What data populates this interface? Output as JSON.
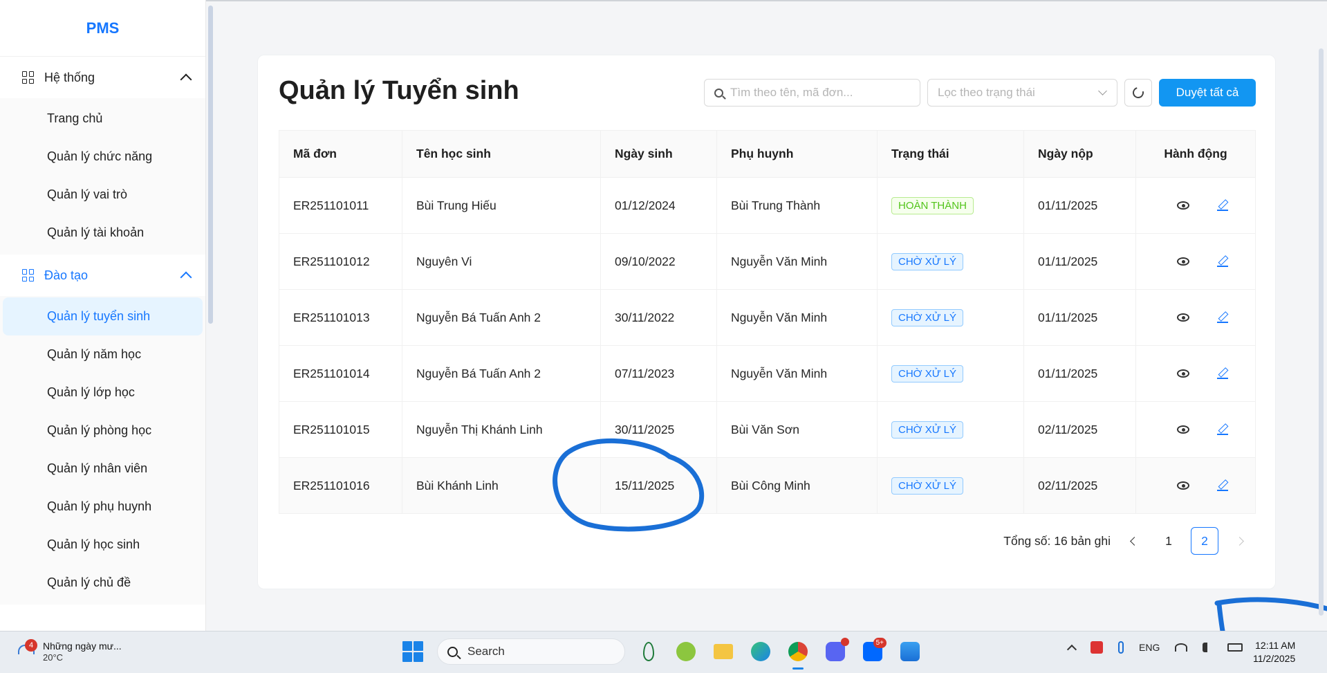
{
  "sidebar": {
    "logo": "PMS",
    "groups": [
      {
        "label": "Hệ thống",
        "items": [
          "Trang chủ",
          "Quản lý chức năng",
          "Quản lý vai trò",
          "Quản lý tài khoản"
        ]
      },
      {
        "label": "Đào tạo",
        "items": [
          "Quản lý tuyển sinh",
          "Quản lý năm học",
          "Quản lý lớp học",
          "Quản lý phòng học",
          "Quản lý nhân viên",
          "Quản lý phụ huynh",
          "Quản lý học sinh",
          "Quản lý chủ đề"
        ],
        "selected": "Quản lý tuyển sinh"
      }
    ]
  },
  "page": {
    "title": "Quản lý Tuyển sinh",
    "search_placeholder": "Tìm theo tên, mã đơn...",
    "filter_placeholder": "Lọc theo trạng thái",
    "approve_all_label": "Duyệt tất cả"
  },
  "table": {
    "columns": [
      "Mã đơn",
      "Tên học sinh",
      "Ngày sinh",
      "Phụ huynh",
      "Trạng thái",
      "Ngày nộp",
      "Hành động"
    ],
    "rows": [
      {
        "code": "ER251101011",
        "student": "Bùi Trung Hiếu",
        "dob": "01/12/2024",
        "parent": "Bùi Trung Thành",
        "status": "HOÀN THÀNH",
        "status_type": "done",
        "submitted": "01/11/2025"
      },
      {
        "code": "ER251101012",
        "student": "Nguyên Vi",
        "dob": "09/10/2022",
        "parent": "Nguyễn Văn Minh",
        "status": "CHỜ XỬ LÝ",
        "status_type": "pending",
        "submitted": "01/11/2025"
      },
      {
        "code": "ER251101013",
        "student": "Nguyễn Bá Tuấn Anh 2",
        "dob": "30/11/2022",
        "parent": "Nguyễn Văn Minh",
        "status": "CHỜ XỬ LÝ",
        "status_type": "pending",
        "submitted": "01/11/2025"
      },
      {
        "code": "ER251101014",
        "student": "Nguyễn Bá Tuấn Anh 2",
        "dob": "07/11/2023",
        "parent": "Nguyễn Văn Minh",
        "status": "CHỜ XỬ LÝ",
        "status_type": "pending",
        "submitted": "01/11/2025"
      },
      {
        "code": "ER251101015",
        "student": "Nguyễn Thị Khánh Linh",
        "dob": "30/11/2025",
        "parent": "Bùi Văn Sơn",
        "status": "CHỜ XỬ LÝ",
        "status_type": "pending",
        "submitted": "02/11/2025"
      },
      {
        "code": "ER251101016",
        "student": "Bùi Khánh Linh",
        "dob": "15/11/2025",
        "parent": "Bùi Công Minh",
        "status": "CHỜ XỬ LÝ",
        "status_type": "pending",
        "submitted": "02/11/2025"
      }
    ]
  },
  "pagination": {
    "total_text": "Tổng số: 16 bản ghi",
    "pages": [
      "1",
      "2"
    ],
    "current": "2"
  },
  "taskbar": {
    "weather_text": "Những ngày mư...",
    "weather_temp": "20°C",
    "weather_badge": "4",
    "search_label": "Search",
    "zalo_badge": "5+",
    "language": "ENG",
    "time": "12:11 AM",
    "date": "11/2/2025"
  },
  "colors": {
    "accent": "#1677ff",
    "primary_button": "#1296f2",
    "annotation": "#1a6fd6"
  }
}
